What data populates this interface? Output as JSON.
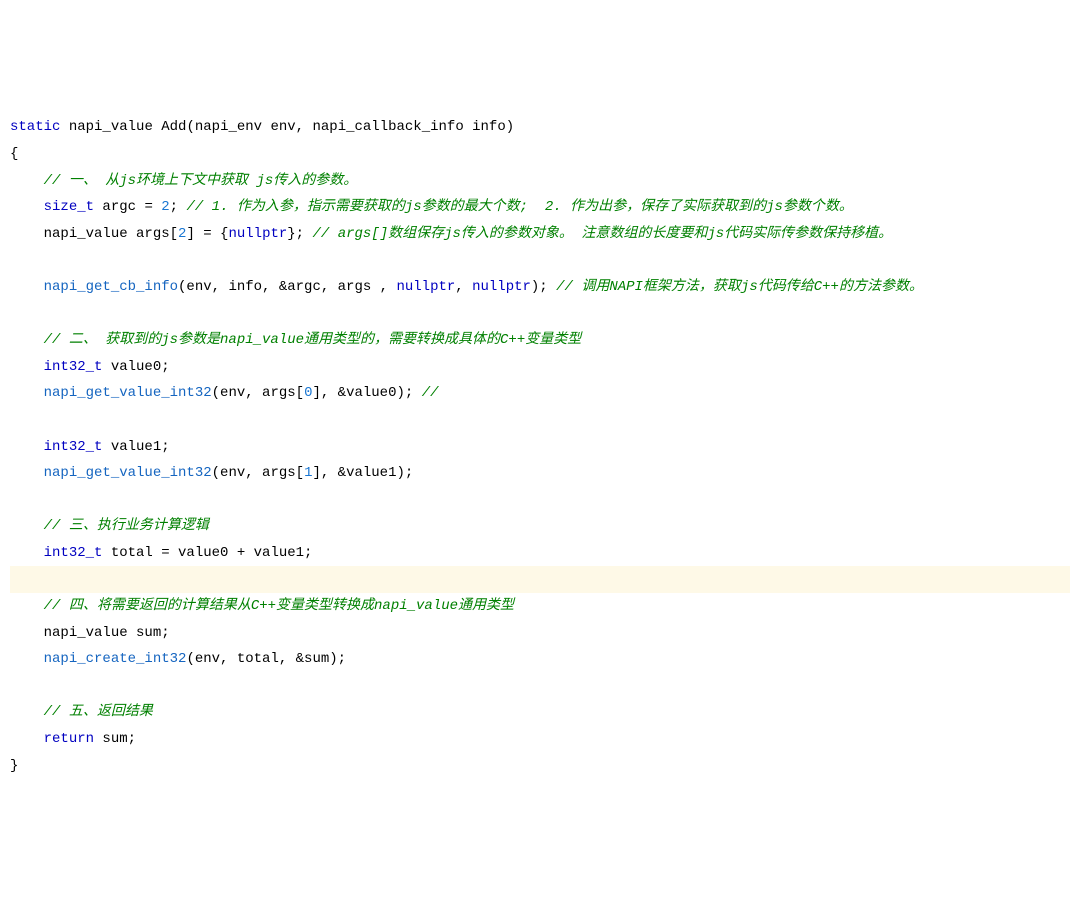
{
  "code": {
    "line1": {
      "static": "static",
      "type1": "napi_value",
      "func": "Add",
      "params": "(napi_env env, napi_callback_info info)"
    },
    "line2": "{",
    "line3_indent": "    ",
    "line3_comment": "// 一、 从js环境上下文中获取 js传入的参数。",
    "line4_indent": "    ",
    "line4_type": "size_t",
    "line4_var": " argc = ",
    "line4_num": "2",
    "line4_semi": "; ",
    "line4_comment": "// 1. 作为入参，指示需要获取的js参数的最大个数;  2. 作为出参，保存了实际获取到的js参数个数。",
    "line5_indent": "    ",
    "line5_type": "napi_value",
    "line5_var": " args[",
    "line5_num": "2",
    "line5_close": "] = {",
    "line5_null": "nullptr",
    "line5_end": "}; ",
    "line5_comment": "// args[]数组保存js传入的参数对象。 注意数组的长度要和js代码实际传参数保持移植。",
    "line7_indent": "    ",
    "line7_func": "napi_get_cb_info",
    "line7_args1": "(env, info, &argc, args , ",
    "line7_null1": "nullptr",
    "line7_comma": ", ",
    "line7_null2": "nullptr",
    "line7_close": "); ",
    "line7_comment": "// 调用NAPI框架方法，获取js代码传给C++的方法参数。",
    "line9_indent": "    ",
    "line9_comment": "// 二、 获取到的js参数是napi_value通用类型的，需要转换成具体的C++变量类型",
    "line10_indent": "    ",
    "line10_type": "int32_t",
    "line10_var": " value0;",
    "line11_indent": "    ",
    "line11_func": "napi_get_value_int32",
    "line11_args1": "(env, args[",
    "line11_num": "0",
    "line11_args2": "], &value0); ",
    "line11_comment": "//",
    "line13_indent": "    ",
    "line13_type": "int32_t",
    "line13_var": " value1;",
    "line14_indent": "    ",
    "line14_func": "napi_get_value_int32",
    "line14_args1": "(env, args[",
    "line14_num": "1",
    "line14_args2": "], &value1);",
    "line16_indent": "    ",
    "line16_comment": "// 三、执行业务计算逻辑",
    "line17_indent": "    ",
    "line17_type": "int32_t",
    "line17_var": " total = value0 + value1;",
    "line19_indent": "    ",
    "line19_comment": "// 四、将需要返回的计算结果从C++变量类型转换成napi_value通用类型",
    "line20_indent": "    ",
    "line20_type": "napi_value",
    "line20_var": " sum;",
    "line21_indent": "    ",
    "line21_func": "napi_create_int32",
    "line21_args": "(env, total, &sum);",
    "line23_indent": "    ",
    "line23_comment": "// 五、返回结果",
    "line24_indent": "    ",
    "line24_return": "return",
    "line24_var": " sum;",
    "line25": "}"
  }
}
